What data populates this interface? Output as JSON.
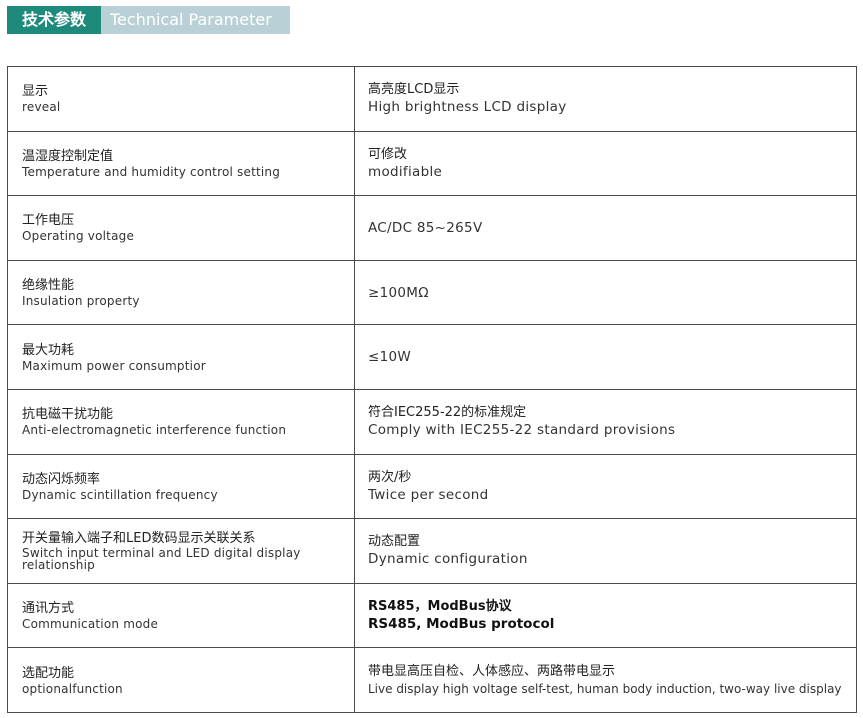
{
  "header": {
    "title_cn": "技术参数",
    "title_en": "Technical Parameter"
  },
  "rows": [
    {
      "label_cn": "显示",
      "label_en": "reveal",
      "value_cn": "高亮度LCD显示",
      "value_en": "High brightness LCD display"
    },
    {
      "label_cn": "温湿度控制定值",
      "label_en": "Temperature and humidity control setting",
      "value_cn": "可修改",
      "value_en": "modifiable"
    },
    {
      "label_cn": "工作电压",
      "label_en": "Operating voltage",
      "value_cn": "",
      "value_en": "AC/DC 85~265V"
    },
    {
      "label_cn": "绝缘性能",
      "label_en": "Insulation property",
      "value_cn": "",
      "value_en": "≥100MΩ"
    },
    {
      "label_cn": "最大功耗",
      "label_en": "Maximum power consumptior",
      "value_cn": "",
      "value_en": "≤10W"
    },
    {
      "label_cn": "抗电磁干扰功能",
      "label_en": "Anti-electromagnetic interference function",
      "value_cn": "符合IEC255-22的标准规定",
      "value_en": "Comply with IEC255-22 standard provisions"
    },
    {
      "label_cn": "动态闪烁频率",
      "label_en": "Dynamic scintillation frequency",
      "value_cn": "两次/秒",
      "value_en": "Twice per second"
    },
    {
      "label_cn": "开关量输入端子和LED数码显示关联关系",
      "label_en": "Switch input terminal and LED digital display relationship",
      "value_cn": "动态配置",
      "value_en": "Dynamic configuration"
    },
    {
      "label_cn": "通讯方式",
      "label_en": "Communication mode",
      "value_cn": "RS485，ModBus协议",
      "value_en": "RS485, ModBus protocol"
    },
    {
      "label_cn": "选配功能",
      "label_en": "optionalfunction",
      "value_cn": "带电显高压自检、人体感应、两路带电显示",
      "value_en": "Live display high voltage self-test, human body induction, two-way live display"
    }
  ]
}
